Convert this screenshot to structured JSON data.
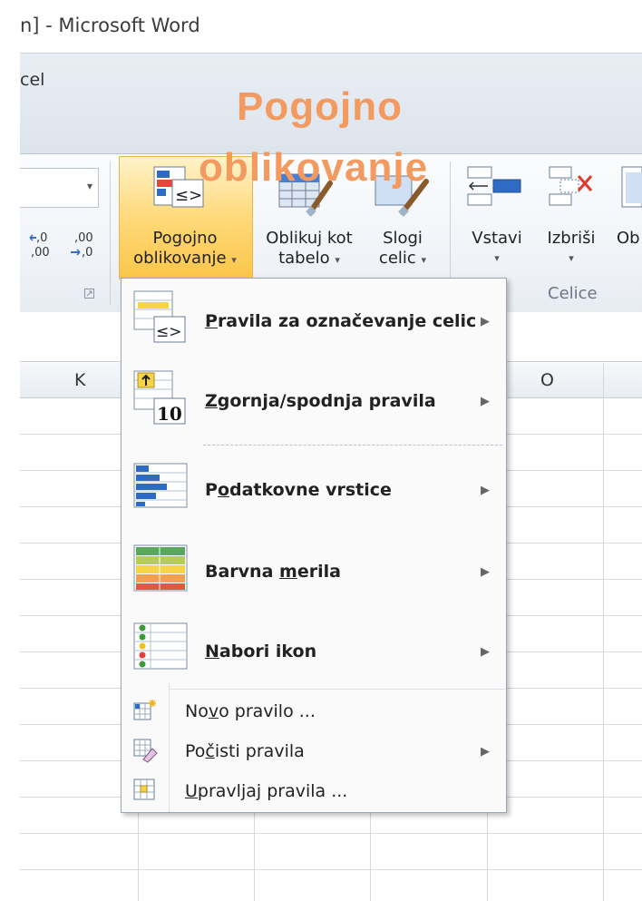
{
  "window": {
    "title": "n]  -  Microsoft Word"
  },
  "tabs": {
    "partial_tab": "cel"
  },
  "overlay": {
    "line1": "Pogojno",
    "line2": "oblikovanje"
  },
  "ribbon": {
    "number_format_arrow": "▾",
    "increase_decimal": "←,0\n,00",
    "decrease_decimal": ",00\n→,0",
    "conditional_formatting": {
      "line1": "Pogojno",
      "line2": "oblikovanje",
      "arrow": "▾"
    },
    "format_as_table": {
      "line1": "Oblikuj kot",
      "line2": "tabelo",
      "arrow": "▾"
    },
    "cell_styles": {
      "line1": "Slogi",
      "line2": "celic",
      "arrow": "▾"
    },
    "insert": {
      "label": "Vstavi",
      "arrow": "▾"
    },
    "delete": {
      "label": "Izbriši",
      "arrow": "▾"
    },
    "format_partial": {
      "label": "Ob"
    },
    "cells_group_label": "Celice"
  },
  "sheet": {
    "columns": [
      "K",
      "O"
    ]
  },
  "menu": {
    "items": [
      {
        "pre": "",
        "ul": "P",
        "post": "ravila za označevanje celic",
        "icon": "highlight-cells-rules-icon"
      },
      {
        "pre": "",
        "ul": "Z",
        "post": "gornja/spodnja pravila",
        "icon": "top-bottom-rules-icon"
      },
      {
        "pre": "P",
        "ul": "o",
        "post": "datkovne vrstice",
        "icon": "data-bars-icon"
      },
      {
        "pre": "Barvna ",
        "ul": "m",
        "post": "erila",
        "icon": "color-scales-icon"
      },
      {
        "pre": "",
        "ul": "N",
        "post": "abori ikon",
        "icon": "icon-sets-icon"
      }
    ],
    "commands": [
      {
        "pre": "No",
        "ul": "v",
        "post": "o pravilo ...",
        "icon": "new-rule-icon"
      },
      {
        "pre": "Po",
        "ul": "č",
        "post": "isti pravila",
        "icon": "clear-rules-icon"
      },
      {
        "pre": "",
        "ul": "U",
        "post": "pravljaj pravila ...",
        "icon": "manage-rules-icon"
      }
    ],
    "submenu_arrow": "▶"
  },
  "colors": {
    "overlay": "#f29a5f",
    "active_button": "#ffd97a",
    "menu_border": "#9aa6b4"
  }
}
